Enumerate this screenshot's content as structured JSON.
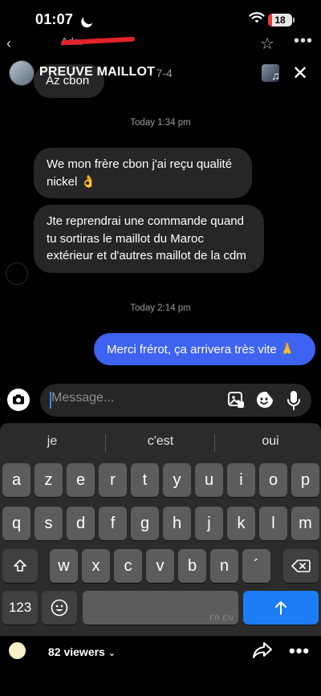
{
  "status": {
    "time": "01:07",
    "battery": "18",
    "battery_level": 0.18
  },
  "underlying": {
    "name": "Adm"
  },
  "header": {
    "title": "PREUVE MAILLOT",
    "subtitle": "· 7-4"
  },
  "messages": {
    "prev_text": "Az cbon",
    "time1": "Today 1:34 pm",
    "m1": "We mon frère cbon j'ai reçu qualité nickel 👌",
    "m2": "Jte reprendrai une commande quand tu sortiras le maillot du Maroc extérieur et d'autres maillot de la cdm",
    "time2": "Today 2:14 pm",
    "m3": "Merci frérot, ça arrivera très vite 🙏"
  },
  "composer": {
    "placeholder": "Message..."
  },
  "keyboard": {
    "suggestions": [
      "je",
      "c'est",
      "oui"
    ],
    "row1": [
      "a",
      "z",
      "e",
      "r",
      "t",
      "y",
      "u",
      "i",
      "o",
      "p"
    ],
    "row2": [
      "q",
      "s",
      "d",
      "f",
      "g",
      "h",
      "j",
      "k",
      "l",
      "m"
    ],
    "row3": [
      "w",
      "x",
      "c",
      "v",
      "b",
      "n",
      "´"
    ],
    "numbers_label": "123",
    "space_lang": "FR EN"
  },
  "footer": {
    "viewers": "82 viewers"
  }
}
